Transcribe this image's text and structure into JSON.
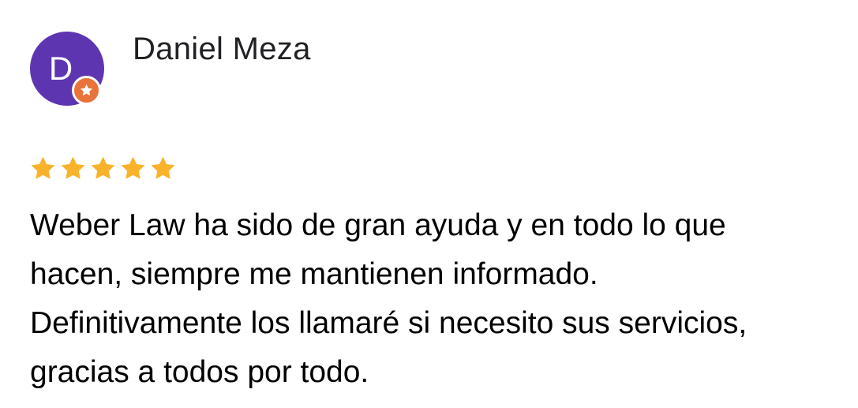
{
  "reviewer": {
    "name": "Daniel Meza",
    "avatar_letter": "D",
    "avatar_color": "#5e35b1",
    "badge_icon": "local-guide-star-icon",
    "badge_color": "#e8743b"
  },
  "rating": {
    "stars": 5,
    "max_stars": 5,
    "star_color": "#f9b32b",
    "star_icon": "star-icon"
  },
  "review": {
    "lines": [
      "Weber Law ha sido de gran ayuda y en todo lo que",
      "hacen, siempre me mantienen informado.",
      "Definitivamente los llamaré si necesito sus servicios,",
      "gracias a todos por todo."
    ]
  }
}
